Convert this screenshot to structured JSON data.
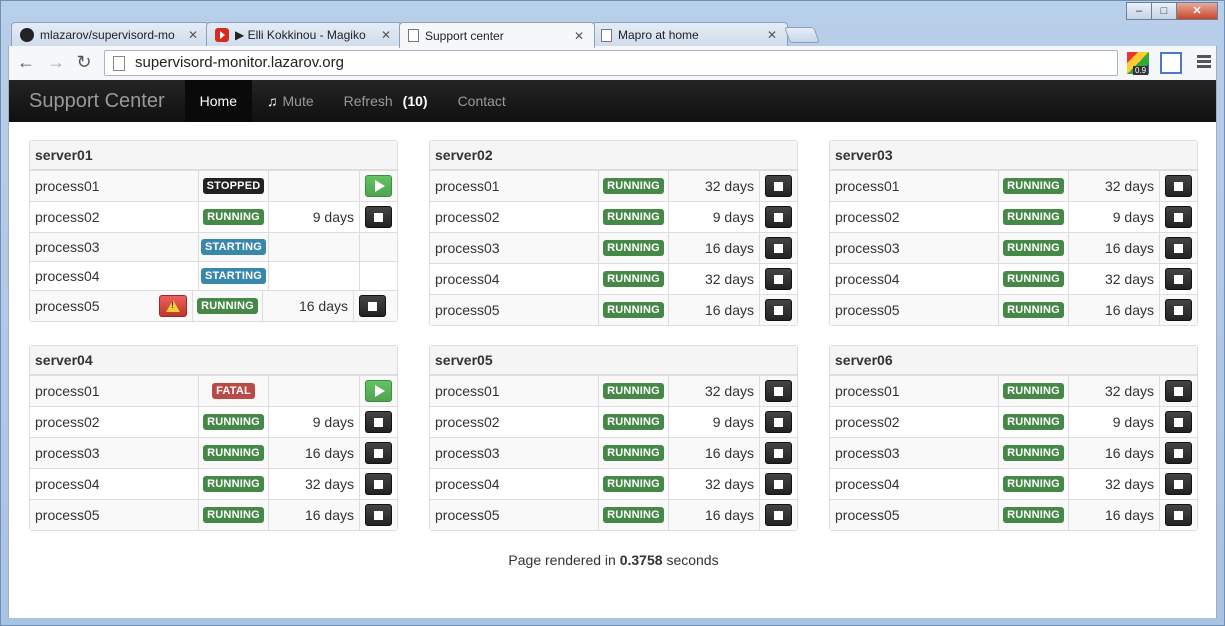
{
  "browser": {
    "tabs": [
      {
        "title": "mlazarov/supervisord-mo",
        "icon": "github-icon"
      },
      {
        "title": "▶ Elli Kokkinou - Magiko",
        "icon": "youtube-icon"
      },
      {
        "title": "Support center",
        "icon": "page-icon"
      },
      {
        "title": "Mapro at home",
        "icon": "page-icon"
      }
    ],
    "url": "supervisord-monitor.lazarov.org",
    "ext_badge": "0.9"
  },
  "navbar": {
    "brand": "Support Center",
    "home": "Home",
    "mute": "Mute",
    "refresh": "Refresh",
    "refresh_count": "(10)",
    "contact": "Contact"
  },
  "servers": [
    {
      "name": "server01",
      "processes": [
        {
          "name": "process01",
          "state": "STOPPED",
          "uptime": "",
          "action": "start"
        },
        {
          "name": "process02",
          "state": "RUNNING",
          "uptime": "9 days",
          "action": "stop"
        },
        {
          "name": "process03",
          "state": "STARTING",
          "uptime": "",
          "action": ""
        },
        {
          "name": "process04",
          "state": "STARTING",
          "uptime": "",
          "action": ""
        },
        {
          "name": "process05",
          "state": "RUNNING",
          "uptime": "16 days",
          "action": "stop",
          "warning": true
        }
      ]
    },
    {
      "name": "server02",
      "processes": [
        {
          "name": "process01",
          "state": "RUNNING",
          "uptime": "32 days",
          "action": "stop"
        },
        {
          "name": "process02",
          "state": "RUNNING",
          "uptime": "9 days",
          "action": "stop"
        },
        {
          "name": "process03",
          "state": "RUNNING",
          "uptime": "16 days",
          "action": "stop"
        },
        {
          "name": "process04",
          "state": "RUNNING",
          "uptime": "32 days",
          "action": "stop"
        },
        {
          "name": "process05",
          "state": "RUNNING",
          "uptime": "16 days",
          "action": "stop"
        }
      ]
    },
    {
      "name": "server03",
      "processes": [
        {
          "name": "process01",
          "state": "RUNNING",
          "uptime": "32 days",
          "action": "stop"
        },
        {
          "name": "process02",
          "state": "RUNNING",
          "uptime": "9 days",
          "action": "stop"
        },
        {
          "name": "process03",
          "state": "RUNNING",
          "uptime": "16 days",
          "action": "stop"
        },
        {
          "name": "process04",
          "state": "RUNNING",
          "uptime": "32 days",
          "action": "stop"
        },
        {
          "name": "process05",
          "state": "RUNNING",
          "uptime": "16 days",
          "action": "stop"
        }
      ]
    },
    {
      "name": "server04",
      "processes": [
        {
          "name": "process01",
          "state": "FATAL",
          "uptime": "",
          "action": "start"
        },
        {
          "name": "process02",
          "state": "RUNNING",
          "uptime": "9 days",
          "action": "stop"
        },
        {
          "name": "process03",
          "state": "RUNNING",
          "uptime": "16 days",
          "action": "stop"
        },
        {
          "name": "process04",
          "state": "RUNNING",
          "uptime": "32 days",
          "action": "stop"
        },
        {
          "name": "process05",
          "state": "RUNNING",
          "uptime": "16 days",
          "action": "stop"
        }
      ]
    },
    {
      "name": "server05",
      "processes": [
        {
          "name": "process01",
          "state": "RUNNING",
          "uptime": "32 days",
          "action": "stop"
        },
        {
          "name": "process02",
          "state": "RUNNING",
          "uptime": "9 days",
          "action": "stop"
        },
        {
          "name": "process03",
          "state": "RUNNING",
          "uptime": "16 days",
          "action": "stop"
        },
        {
          "name": "process04",
          "state": "RUNNING",
          "uptime": "32 days",
          "action": "stop"
        },
        {
          "name": "process05",
          "state": "RUNNING",
          "uptime": "16 days",
          "action": "stop"
        }
      ]
    },
    {
      "name": "server06",
      "processes": [
        {
          "name": "process01",
          "state": "RUNNING",
          "uptime": "32 days",
          "action": "stop"
        },
        {
          "name": "process02",
          "state": "RUNNING",
          "uptime": "9 days",
          "action": "stop"
        },
        {
          "name": "process03",
          "state": "RUNNING",
          "uptime": "16 days",
          "action": "stop"
        },
        {
          "name": "process04",
          "state": "RUNNING",
          "uptime": "32 days",
          "action": "stop"
        },
        {
          "name": "process05",
          "state": "RUNNING",
          "uptime": "16 days",
          "action": "stop"
        }
      ]
    }
  ],
  "footer": {
    "prefix": "Page rendered in",
    "time": "0.3758",
    "suffix": "seconds"
  },
  "colors": {
    "running": "#468847",
    "stopped": "#222222",
    "starting": "#3a87ad",
    "fatal": "#b94a48",
    "navbar": "#1b1b1b"
  }
}
